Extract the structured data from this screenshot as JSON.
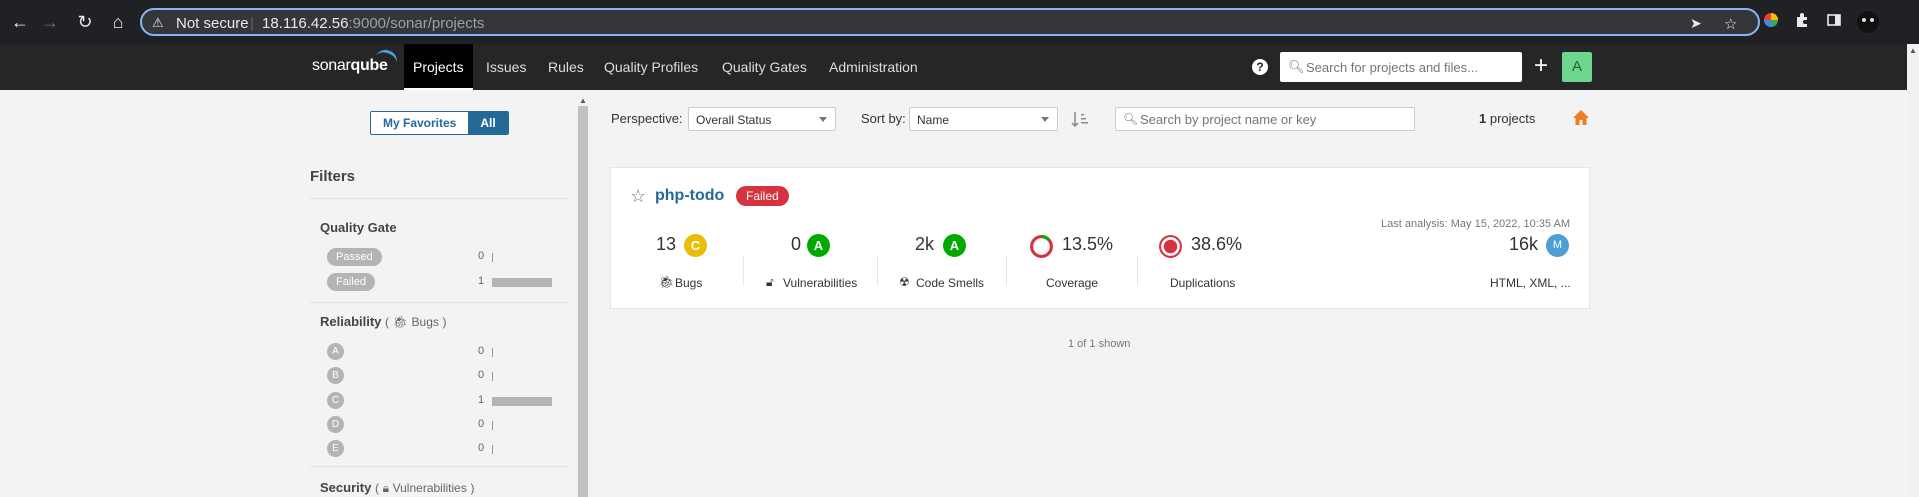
{
  "browser": {
    "security_label": "Not secure",
    "url_host": "18.116.42.56",
    "url_rest": ":9000/sonar/projects"
  },
  "nav": {
    "logo_a": "sonar",
    "logo_b": "qube",
    "items": [
      {
        "label": "Projects",
        "active": true
      },
      {
        "label": "Issues"
      },
      {
        "label": "Rules"
      },
      {
        "label": "Quality Profiles"
      },
      {
        "label": "Quality Gates"
      },
      {
        "label": "Administration"
      }
    ],
    "help_glyph": "?",
    "search_placeholder": "Search for projects and files...",
    "plus_glyph": "+",
    "avatar_letter": "A"
  },
  "sidebar": {
    "favorites_label": "My Favorites",
    "all_label": "All",
    "filters_title": "Filters",
    "quality_gate": {
      "title": "Quality Gate",
      "rows": [
        {
          "label": "Passed",
          "count": "0",
          "fraction": 0
        },
        {
          "label": "Failed",
          "count": "1",
          "fraction": 1
        }
      ]
    },
    "reliability": {
      "title": "Reliability",
      "sub": "Bugs",
      "rows": [
        {
          "label": "A",
          "count": "0",
          "fraction": 0
        },
        {
          "label": "B",
          "count": "0",
          "fraction": 0
        },
        {
          "label": "C",
          "count": "1",
          "fraction": 1
        },
        {
          "label": "D",
          "count": "0",
          "fraction": 0
        },
        {
          "label": "E",
          "count": "0",
          "fraction": 0
        }
      ]
    },
    "security": {
      "title": "Security",
      "sub": "Vulnerabilities"
    }
  },
  "toolbar": {
    "perspective_label": "Perspective:",
    "perspective_value": "Overall Status",
    "sort_label": "Sort by:",
    "sort_value": "Name",
    "search_placeholder": "Search by project name or key",
    "count_number": "1",
    "count_text": " projects"
  },
  "project": {
    "name": "php-todo",
    "quality_gate": "Failed",
    "last_analysis": "Last analysis: May 15, 2022, 10:35 AM",
    "bugs": {
      "value": "13",
      "rating": "C",
      "label": "Bugs"
    },
    "vulnerabilities": {
      "value": "0",
      "rating": "A",
      "label": "Vulnerabilities"
    },
    "code_smells": {
      "value": "2k",
      "rating": "A",
      "label": "Code Smells"
    },
    "coverage": {
      "value": "13.5%",
      "label": "Coverage",
      "percent": 13.5
    },
    "duplications": {
      "value": "38.6%",
      "label": "Duplications"
    },
    "size": {
      "value": "16k",
      "rating": "M",
      "languages": "HTML, XML, ..."
    }
  },
  "footer": {
    "shown": "1 of 1 shown"
  },
  "colors": {
    "accent": "#236a97",
    "failed": "#d4333f",
    "rating_a": "#00aa00",
    "rating_c": "#eabe06",
    "coverage_good": "#00aa00",
    "coverage_bad": "#d4333f",
    "home": "#ed7d20"
  }
}
